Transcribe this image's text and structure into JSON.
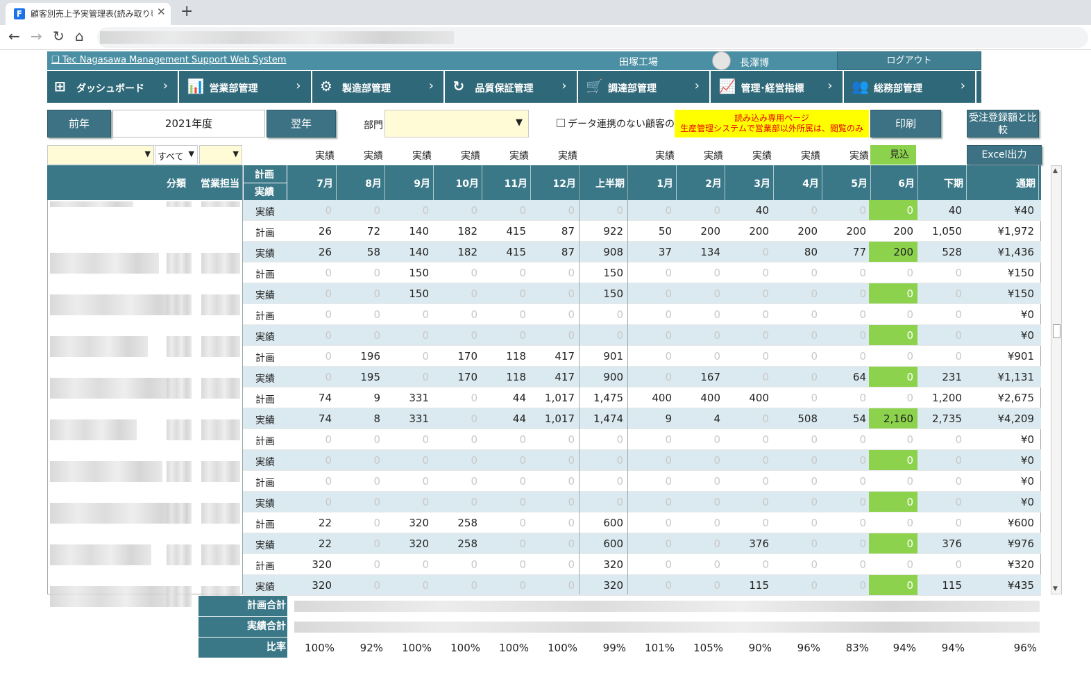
{
  "browser": {
    "tab_title": "顧客別売上予実管理表(読み取り専",
    "favicon": "F"
  },
  "header": {
    "system_title": "Tec Nagasawa Management Support Web System",
    "factory": "田塚工場",
    "user_name": "長澤博",
    "logout": "ログアウト"
  },
  "menu": [
    {
      "icon": "grid-icon",
      "glyph": "⊞",
      "label": "ダッシュボード"
    },
    {
      "icon": "chart-icon",
      "glyph": "📊",
      "label": "営業部管理"
    },
    {
      "icon": "gear-icon",
      "glyph": "⚙",
      "label": "製造部管理"
    },
    {
      "icon": "refresh-icon",
      "glyph": "↻",
      "label": "品質保証管理"
    },
    {
      "icon": "cart-icon",
      "glyph": "🛒",
      "label": "調達部管理"
    },
    {
      "icon": "chart-icon",
      "glyph": "📈",
      "label": "管理･経営指標"
    },
    {
      "icon": "users-icon",
      "glyph": "👥",
      "label": "総務部管理"
    }
  ],
  "toolbar": {
    "prev": "前年",
    "year": "2021年度",
    "next": "翌年",
    "dept_label": "部門",
    "no_link_label": "データ連携のない顧客のみ",
    "notice_line1": "読み込み専用ページ",
    "notice_line2": "生産管理システムで営業部以外所属は、閲覧のみ",
    "print": "印刷",
    "compare": "受注登録額と比較",
    "excel": "Excel出力"
  },
  "filters": {
    "category_value": "すべて"
  },
  "columns": {
    "category": "分類",
    "sales_rep": "営業担当",
    "plan": "計画",
    "actual": "実績",
    "months": [
      "7月",
      "8月",
      "9月",
      "10月",
      "11月",
      "12月",
      "上半期",
      "1月",
      "2月",
      "3月",
      "4月",
      "5月",
      "6月",
      "下期",
      "通期"
    ],
    "top_labels": [
      "実績",
      "実績",
      "実績",
      "実績",
      "実績",
      "実績",
      "",
      "実績",
      "実績",
      "実績",
      "実績",
      "実績",
      "見込",
      "",
      ""
    ]
  },
  "rows": [
    {
      "t": "実績",
      "v": [
        "0",
        "0",
        "0",
        "0",
        "0",
        "0",
        "0",
        "0",
        "0",
        "40",
        "0",
        "0",
        "0",
        "40",
        "¥40"
      ]
    },
    {
      "t": "計画",
      "v": [
        "26",
        "72",
        "140",
        "182",
        "415",
        "87",
        "922",
        "50",
        "200",
        "200",
        "200",
        "200",
        "200",
        "1,050",
        "¥1,972"
      ]
    },
    {
      "t": "実績",
      "v": [
        "26",
        "58",
        "140",
        "182",
        "415",
        "87",
        "908",
        "37",
        "134",
        "0",
        "80",
        "77",
        "200",
        "528",
        "¥1,436"
      ]
    },
    {
      "t": "計画",
      "v": [
        "0",
        "0",
        "150",
        "0",
        "0",
        "0",
        "150",
        "0",
        "0",
        "0",
        "0",
        "0",
        "0",
        "0",
        "¥150"
      ]
    },
    {
      "t": "実績",
      "v": [
        "0",
        "0",
        "150",
        "0",
        "0",
        "0",
        "150",
        "0",
        "0",
        "0",
        "0",
        "0",
        "0",
        "0",
        "¥150"
      ]
    },
    {
      "t": "計画",
      "v": [
        "0",
        "0",
        "0",
        "0",
        "0",
        "0",
        "0",
        "0",
        "0",
        "0",
        "0",
        "0",
        "0",
        "0",
        "¥0"
      ]
    },
    {
      "t": "実績",
      "v": [
        "0",
        "0",
        "0",
        "0",
        "0",
        "0",
        "0",
        "0",
        "0",
        "0",
        "0",
        "0",
        "0",
        "0",
        "¥0"
      ]
    },
    {
      "t": "計画",
      "v": [
        "0",
        "196",
        "0",
        "170",
        "118",
        "417",
        "901",
        "0",
        "0",
        "0",
        "0",
        "0",
        "0",
        "0",
        "¥901"
      ]
    },
    {
      "t": "実績",
      "v": [
        "0",
        "195",
        "0",
        "170",
        "118",
        "417",
        "900",
        "0",
        "167",
        "0",
        "0",
        "64",
        "0",
        "231",
        "¥1,131"
      ]
    },
    {
      "t": "計画",
      "v": [
        "74",
        "9",
        "331",
        "0",
        "44",
        "1,017",
        "1,475",
        "400",
        "400",
        "400",
        "0",
        "0",
        "0",
        "1,200",
        "¥2,675"
      ]
    },
    {
      "t": "実績",
      "v": [
        "74",
        "8",
        "331",
        "0",
        "44",
        "1,017",
        "1,474",
        "9",
        "4",
        "0",
        "508",
        "54",
        "2,160",
        "2,735",
        "¥4,209"
      ]
    },
    {
      "t": "計画",
      "v": [
        "0",
        "0",
        "0",
        "0",
        "0",
        "0",
        "0",
        "0",
        "0",
        "0",
        "0",
        "0",
        "0",
        "0",
        "¥0"
      ]
    },
    {
      "t": "実績",
      "v": [
        "0",
        "0",
        "0",
        "0",
        "0",
        "0",
        "0",
        "0",
        "0",
        "0",
        "0",
        "0",
        "0",
        "0",
        "¥0"
      ]
    },
    {
      "t": "計画",
      "v": [
        "0",
        "0",
        "0",
        "0",
        "0",
        "0",
        "0",
        "0",
        "0",
        "0",
        "0",
        "0",
        "0",
        "0",
        "¥0"
      ]
    },
    {
      "t": "実績",
      "v": [
        "0",
        "0",
        "0",
        "0",
        "0",
        "0",
        "0",
        "0",
        "0",
        "0",
        "0",
        "0",
        "0",
        "0",
        "¥0"
      ]
    },
    {
      "t": "計画",
      "v": [
        "22",
        "0",
        "320",
        "258",
        "0",
        "0",
        "600",
        "0",
        "0",
        "0",
        "0",
        "0",
        "0",
        "0",
        "¥600"
      ]
    },
    {
      "t": "実績",
      "v": [
        "22",
        "0",
        "320",
        "258",
        "0",
        "0",
        "600",
        "0",
        "0",
        "376",
        "0",
        "0",
        "0",
        "376",
        "¥976"
      ]
    },
    {
      "t": "計画",
      "v": [
        "320",
        "0",
        "0",
        "0",
        "0",
        "0",
        "320",
        "0",
        "0",
        "0",
        "0",
        "0",
        "0",
        "0",
        "¥320"
      ]
    },
    {
      "t": "実績",
      "v": [
        "320",
        "0",
        "0",
        "0",
        "0",
        "0",
        "320",
        "0",
        "0",
        "115",
        "0",
        "0",
        "0",
        "115",
        "¥435"
      ]
    }
  ],
  "summary": {
    "plan_total": "計画合計",
    "actual_total": "実績合計",
    "ratio_label": "比率",
    "ratios": [
      "100%",
      "92%",
      "100%",
      "100%",
      "100%",
      "100%",
      "99%",
      "101%",
      "105%",
      "90%",
      "96%",
      "83%",
      "94%",
      "94%",
      "96%"
    ]
  }
}
